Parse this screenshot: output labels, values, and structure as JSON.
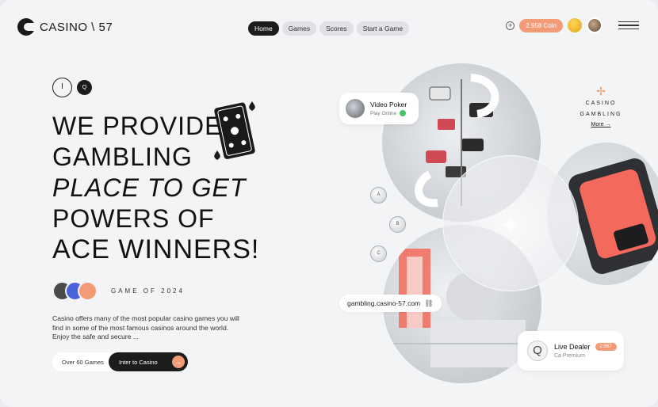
{
  "header": {
    "logo_text": "CASINO \\ 57",
    "nav": [
      {
        "label": "Home",
        "active": true
      },
      {
        "label": "Games",
        "active": false
      },
      {
        "label": "Scores",
        "active": false
      },
      {
        "label": "Start a Game",
        "active": false
      }
    ],
    "coins": "2.958 Coin",
    "accent_color": "#f39a76"
  },
  "hero": {
    "ctrl_left": "I",
    "ctrl_right": "Q",
    "headline": [
      "WE PROVIDE",
      "GAMBLING",
      "PLACE TO GET",
      "POWERS OF",
      "ACE WINNERS!"
    ],
    "game_label": "GAME OF 2024",
    "description": "Casino offers many of the most popular casino games you will find in some of the most famous casinos around the world. Enjoy the safe and secure ...",
    "cta_secondary": "Over 60 Games",
    "cta_primary": "Inter to Casino",
    "cta_arrow": "→"
  },
  "cards": {
    "video_poker": {
      "title": "Video Poker",
      "subtitle": "Play Online"
    },
    "brand": {
      "line1": "CASINO",
      "line2": "GAMBLING",
      "more": "More →",
      "star": "✢"
    },
    "url": {
      "text": "gambling.casino-57.com",
      "icon": "🔗"
    },
    "live_dealer": {
      "title": "Live Dealer",
      "badge": "2.067",
      "subtitle": "Ca Premium",
      "avatar_glyph": "Q"
    }
  },
  "side_coins": [
    "A",
    "B",
    "C"
  ]
}
